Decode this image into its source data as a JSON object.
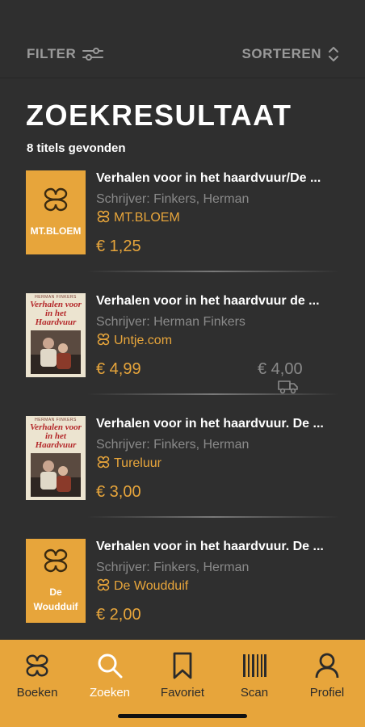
{
  "header": {
    "filter_label": "FILTER",
    "sort_label": "SORTEREN"
  },
  "page_title": "ZOEKRESULTAAT",
  "result_count": "8 titels gevonden",
  "results": [
    {
      "cover_type": "shop",
      "cover_text": "MT.BLOEM",
      "title": "Verhalen voor in het haardvuur/De ...",
      "author": "Schrijver: Finkers, Herman",
      "shop": "MT.BLOEM",
      "price": "€ 1,25"
    },
    {
      "cover_type": "book",
      "book_author": "HERMAN FINKERS",
      "book_title": "Verhalen voor in het Haardvuur",
      "title": "Verhalen voor in het haardvuur de ...",
      "author": "Schrijver: Herman Finkers",
      "shop": "Untje.com",
      "price": "€ 4,99",
      "old_price": "€ 4,00"
    },
    {
      "cover_type": "book",
      "book_author": "HERMAN FINKERS",
      "book_title": "Verhalen voor in het Haardvuur",
      "title": "Verhalen voor in het haardvuur. De ...",
      "author": "Schrijver: Finkers, Herman",
      "shop": "Tureluur",
      "price": "€ 3,00"
    },
    {
      "cover_type": "shop",
      "cover_text": "De Woudduif",
      "title": "Verhalen voor in het haardvuur. De ...",
      "author": "Schrijver: Finkers, Herman",
      "shop": "De Woudduif",
      "price": "€ 2,00"
    }
  ],
  "tabs": [
    {
      "label": "Boeken",
      "icon": "books-logo-icon",
      "active": false
    },
    {
      "label": "Zoeken",
      "icon": "search-icon",
      "active": true
    },
    {
      "label": "Favoriet",
      "icon": "bookmark-icon",
      "active": false
    },
    {
      "label": "Scan",
      "icon": "barcode-icon",
      "active": false
    },
    {
      "label": "Profiel",
      "icon": "profile-icon",
      "active": false
    }
  ],
  "colors": {
    "background": "#2f2f2f",
    "accent": "#e7a53b",
    "muted_text": "#8a8a8a"
  }
}
